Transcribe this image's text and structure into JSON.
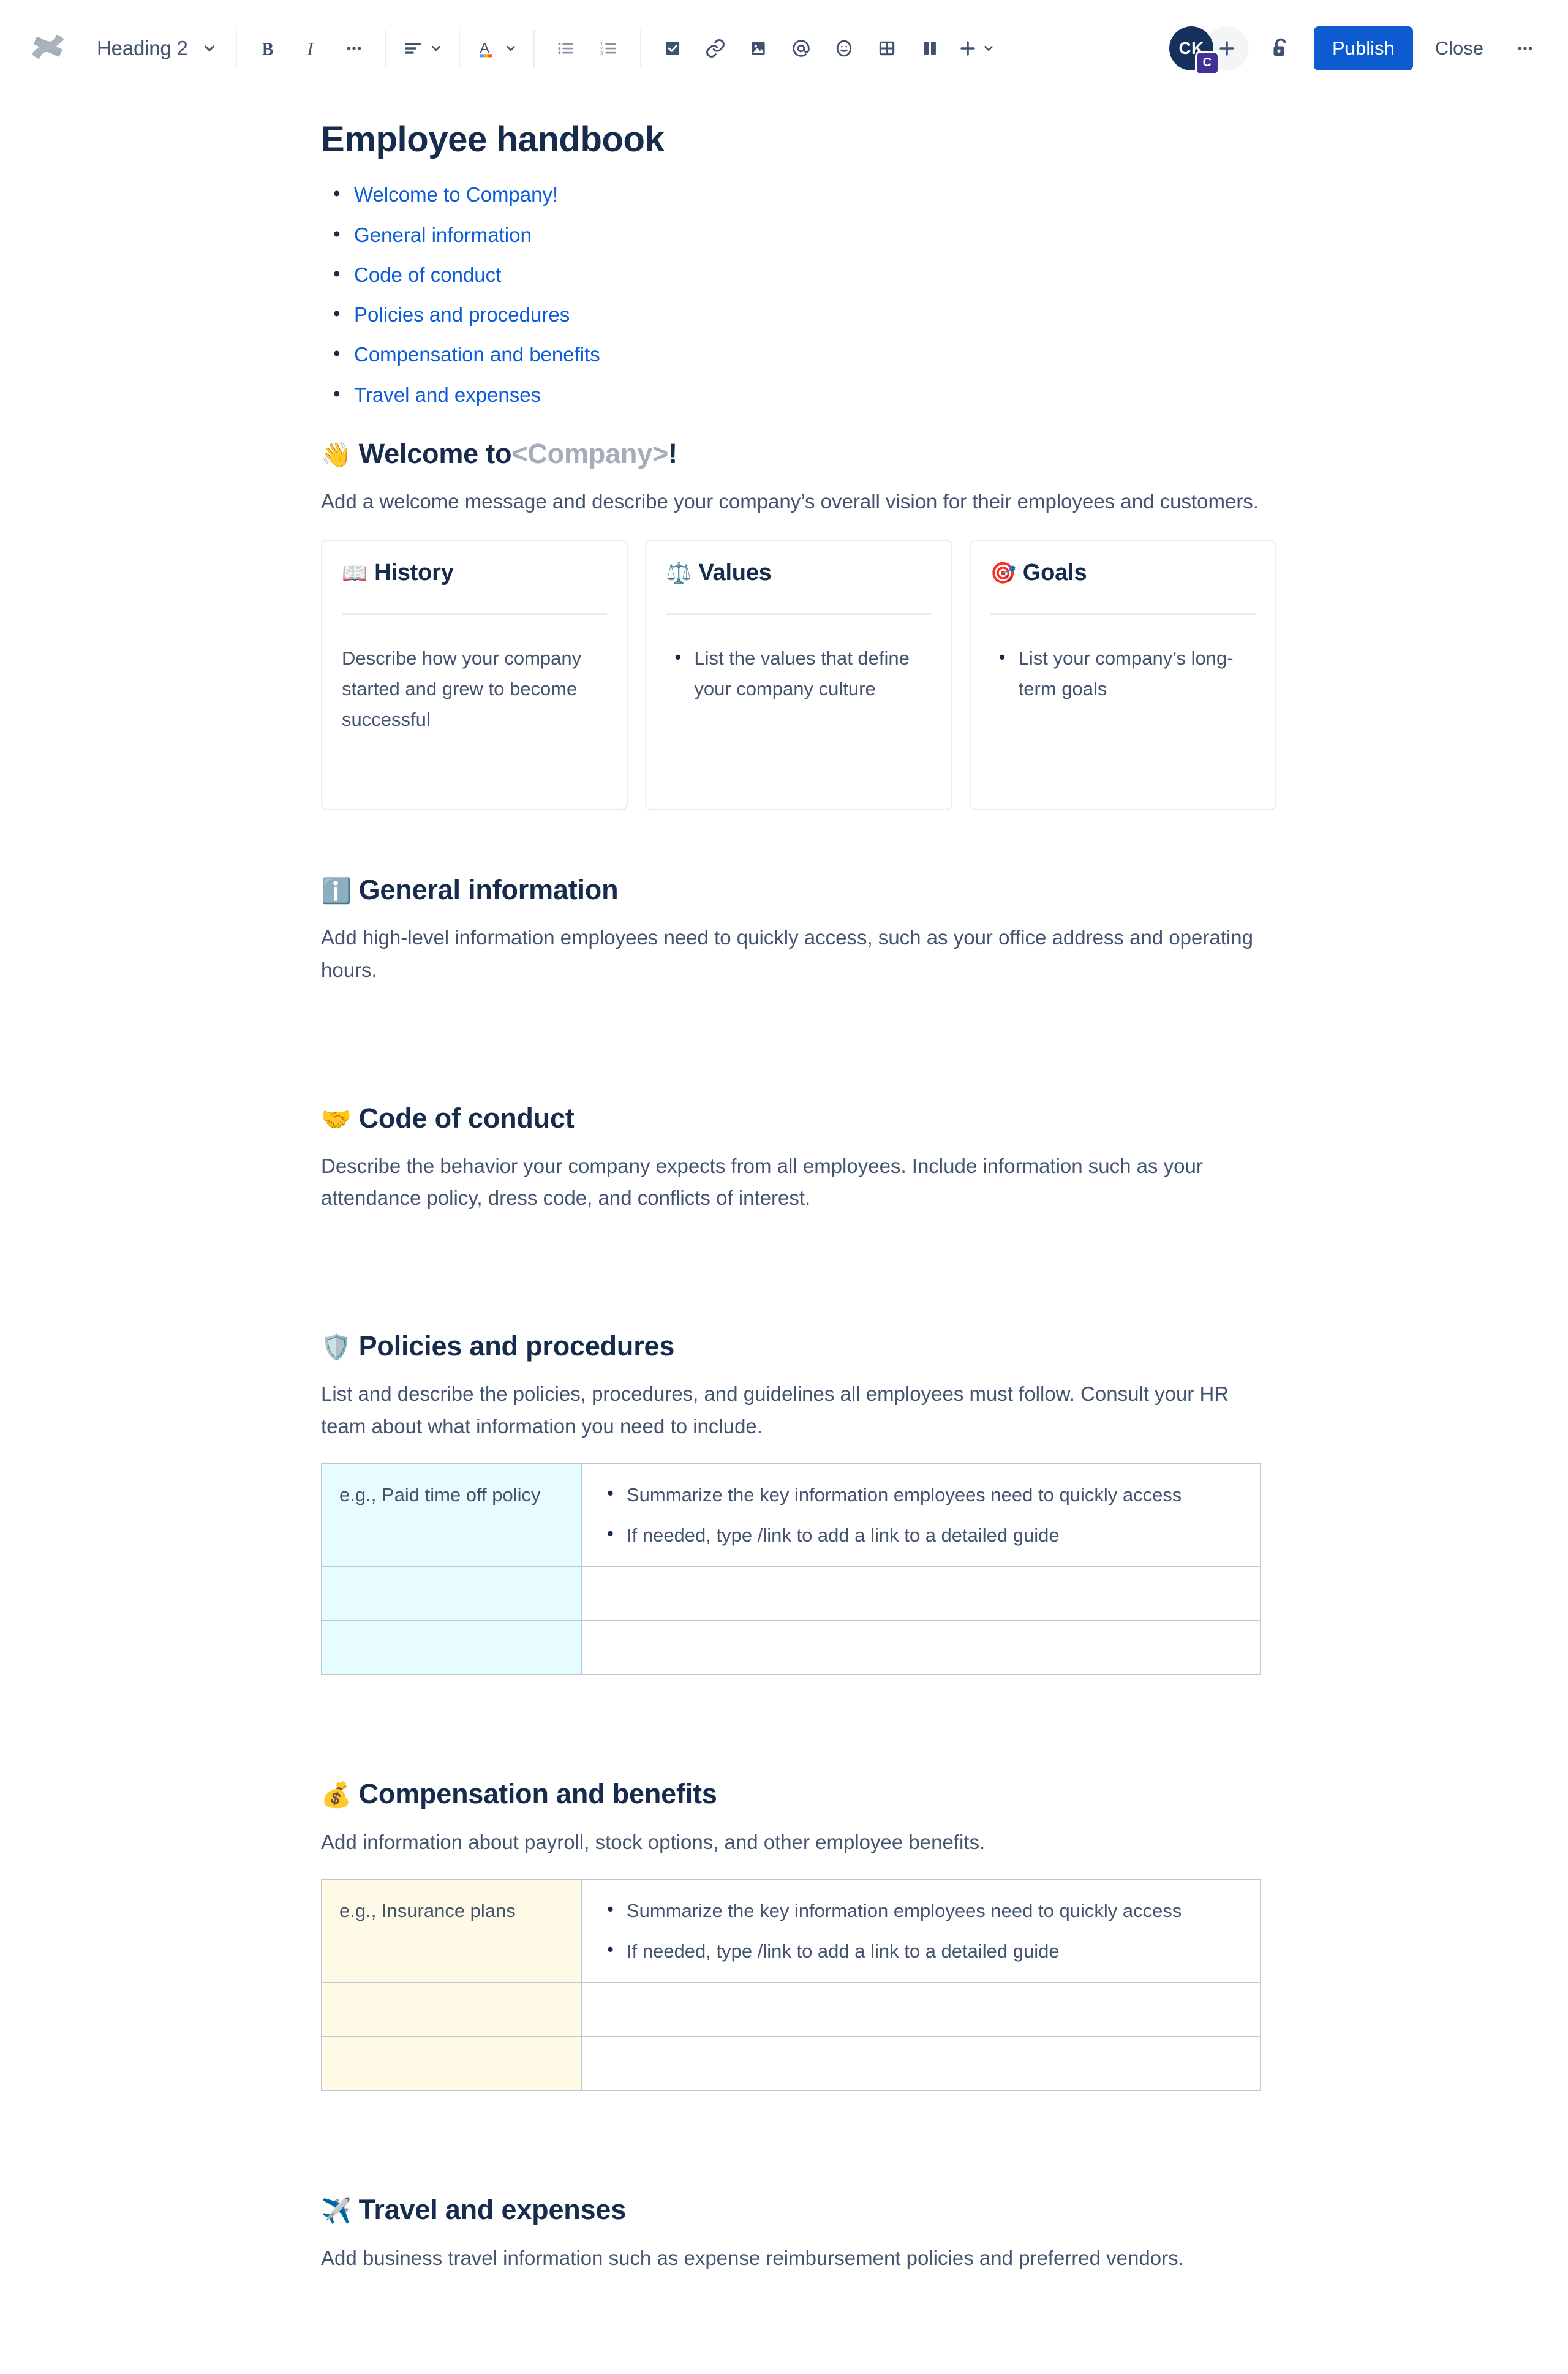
{
  "toolbar": {
    "logo_name": "confluence-logo",
    "style_selector": {
      "value": "Heading 2"
    },
    "buttons": {
      "bold": "B",
      "italic": "I",
      "more_formatting": "•••",
      "text_align": "Text alignment",
      "text_color": "A",
      "bullet_list": "Bulleted list",
      "numbered_list": "Numbered list",
      "task_list": "Action item",
      "link": "Link",
      "image": "Image",
      "mention": "Mention",
      "emoji": "Emoji",
      "table": "Table",
      "layout": "Layouts",
      "insert": "Insert more"
    },
    "avatar": {
      "initials": "CK",
      "badge": "C"
    },
    "add_person_label": "+",
    "restrictions_label": "Restrictions",
    "publish_label": "Publish",
    "close_label": "Close",
    "more_label": "•••"
  },
  "page": {
    "title": "Employee handbook",
    "toc": [
      {
        "label": "Welcome to Company!"
      },
      {
        "label": "General information"
      },
      {
        "label": "Code of conduct"
      },
      {
        "label": "Policies and procedures"
      },
      {
        "label": "Compensation and benefits"
      },
      {
        "label": "Travel and expenses"
      }
    ],
    "sections": {
      "welcome": {
        "emoji": "👋",
        "emoji_name": "waving-hand-emoji",
        "heading_prefix": "Welcome to ",
        "heading_placeholder": "<Company>",
        "heading_suffix": "!",
        "body": "Add a welcome message and describe your company’s overall vision for their employees and customers.",
        "cards": [
          {
            "emoji": "📖",
            "emoji_name": "open-book-emoji",
            "title": "History",
            "type": "paragraph",
            "text": "Describe how your company started and grew to become successful"
          },
          {
            "emoji": "⚖️",
            "emoji_name": "balance-scale-emoji",
            "title": "Values",
            "type": "list",
            "items": [
              "List the values that define your company culture"
            ]
          },
          {
            "emoji": "🎯",
            "emoji_name": "target-emoji",
            "title": "Goals",
            "type": "list",
            "items": [
              "List your company’s long-term goals"
            ]
          }
        ]
      },
      "general_information": {
        "emoji": "ℹ️",
        "emoji_name": "information-emoji",
        "heading": "General information",
        "body": "Add high-level information employees need to quickly access, such as your office address and operating hours."
      },
      "code_of_conduct": {
        "emoji": "🤝",
        "emoji_name": "handshake-emoji",
        "heading": "Code of conduct",
        "body": "Describe the behavior your company expects from all employees. Include information such as your attendance policy, dress code, and conflicts of interest."
      },
      "policies": {
        "emoji": "🛡️",
        "emoji_name": "shield-emoji",
        "heading": "Policies and procedures",
        "body": "List and describe the policies, procedures, and guidelines all employees must follow. Consult your HR team about what information you need to include.",
        "table": {
          "accent": "#E6FCFF",
          "rows": [
            {
              "key": "e.g., Paid time off policy",
              "bullets": [
                "Summarize the key information employees need to quickly access",
                "If needed, type /link to add a link to a detailed guide"
              ]
            },
            {
              "key": "",
              "bullets": []
            },
            {
              "key": "",
              "bullets": []
            }
          ]
        }
      },
      "compensation": {
        "emoji": "💰",
        "emoji_name": "money-bag-emoji",
        "heading": "Compensation and benefits",
        "body": "Add information about payroll, stock options, and other employee benefits.",
        "table": {
          "accent": "#FFFAE6",
          "rows": [
            {
              "key": "e.g., Insurance plans",
              "bullets": [
                "Summarize the key information employees need to quickly access",
                "If needed, type /link to add a link to a detailed guide"
              ]
            },
            {
              "key": "",
              "bullets": []
            },
            {
              "key": "",
              "bullets": []
            }
          ]
        }
      },
      "travel": {
        "emoji": "✈️",
        "emoji_name": "airplane-emoji",
        "heading": "Travel and expenses",
        "body": "Add business travel information such as expense reimbursement policies and preferred vendors."
      }
    }
  },
  "colors": {
    "link": "#0B5CD5",
    "publish": "#0C5BD1",
    "heading": "#172B4D",
    "body_text": "#44546F",
    "placeholder": "#A5ADBA",
    "border": "#EBECF0",
    "table_border": "#C1C7D0"
  }
}
